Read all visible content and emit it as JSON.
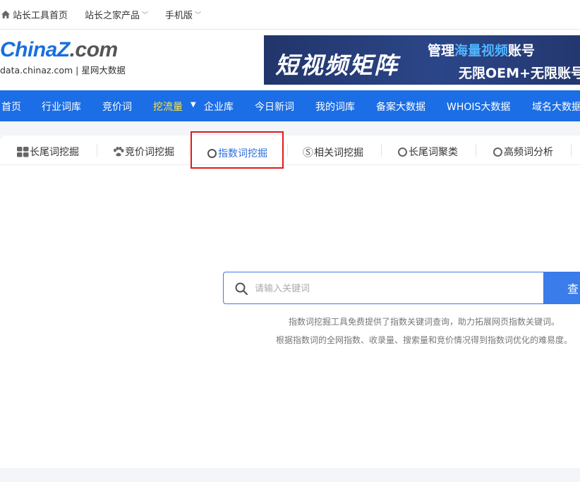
{
  "topbar": {
    "items": [
      {
        "label": "站长工具首页",
        "icon": "home-icon"
      },
      {
        "label": "站长之家产品",
        "caret": "﹀"
      },
      {
        "label": "手机版",
        "caret": "﹀"
      }
    ]
  },
  "logo": {
    "main_part1": "China",
    "main_z": "Z",
    "main_part2": ".com",
    "sub": "data.chinaz.com | 星网大数据"
  },
  "banner": {
    "big": "短视频矩阵",
    "line1_pre": "管理",
    "line1_hl": "海量视频",
    "line1_post": "账号",
    "line2": "无限OEM+无限账号"
  },
  "nav": {
    "items": [
      "首页",
      "行业词库",
      "竞价词",
      "挖流量",
      "企业库",
      "今日新词",
      "我的词库",
      "备案大数据",
      "WHOIS大数据",
      "域名大数据"
    ],
    "drop_glyph": "▼"
  },
  "tabs": {
    "items": [
      {
        "label": "长尾词挖掘",
        "icon": "grid-icon"
      },
      {
        "label": "竞价词挖掘",
        "icon": "paw-icon"
      },
      {
        "label": "指数词挖掘",
        "icon": "ring-icon",
        "active": true
      },
      {
        "label": "相关词挖掘",
        "icon": "s-circle-icon",
        "glyph": "Ⓢ"
      },
      {
        "label": "长尾词聚类",
        "icon": "ring-icon"
      },
      {
        "label": "高频词分析",
        "icon": "ring-icon"
      }
    ]
  },
  "search": {
    "placeholder": "请输入关键词",
    "value": "",
    "button_label": "查"
  },
  "description": {
    "line1": "指数词挖掘工具免费提供了指数关键词查询，助力拓展网页指数关键词。",
    "line2": "根据指数词的全网指数、收录量、搜索量和竞价情况得到指数词优化的难易度。"
  },
  "colors": {
    "nav_bg": "#1b6ee5",
    "nav_active": "#ffe545",
    "accent": "#3a7ce9",
    "highlight": "#e21a1a"
  }
}
